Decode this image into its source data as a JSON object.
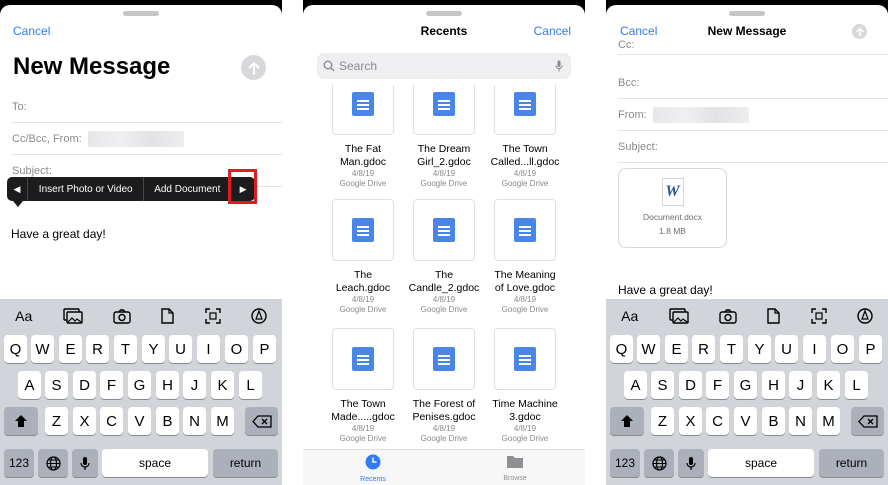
{
  "colors": {
    "accent": "#2f7cf6",
    "highlight": "#e01b24",
    "popup": "#1c1c1e",
    "keyboard": "#d1d4d9",
    "gdoc": "#4a86e8"
  },
  "panel1": {
    "cancel": "Cancel",
    "title": "New Message",
    "to_label": "To:",
    "ccbcc_label": "Cc/Bcc, From:",
    "subject_label": "Subject:",
    "popup": {
      "left_arrow": "◀",
      "item1": "Insert Photo or Video",
      "item2": "Add Document",
      "right_arrow": "▶"
    },
    "body": "Have a great day!"
  },
  "panel2": {
    "title": "Recents",
    "cancel": "Cancel",
    "search_placeholder": "Search",
    "files": [
      {
        "name1": "The Fat",
        "name2": "Man.gdoc",
        "date": "4/8/19",
        "source": "Google Drive"
      },
      {
        "name1": "The Dream",
        "name2": "Girl_2.gdoc",
        "date": "4/8/19",
        "source": "Google Drive"
      },
      {
        "name1": "The Town",
        "name2": "Called...ll.gdoc",
        "date": "4/8/19",
        "source": "Google Drive"
      },
      {
        "name1": "The",
        "name2": "Leach.gdoc",
        "date": "4/8/19",
        "source": "Google Drive"
      },
      {
        "name1": "The",
        "name2": "Candle_2.gdoc",
        "date": "4/8/19",
        "source": "Google Drive"
      },
      {
        "name1": "The Meaning",
        "name2": "of Love.gdoc",
        "date": "4/8/19",
        "source": "Google Drive"
      },
      {
        "name1": "The Town",
        "name2": "Made.....gdoc",
        "date": "4/8/19",
        "source": "Google Drive"
      },
      {
        "name1": "The Forest of",
        "name2": "Penises.gdoc",
        "date": "4/8/19",
        "source": "Google Drive"
      },
      {
        "name1": "Time Machine",
        "name2": "3.gdoc",
        "date": "4/8/19",
        "source": "Google Drive"
      }
    ],
    "tabs": {
      "recents": "Recents",
      "browse": "Browse"
    }
  },
  "panel3": {
    "cancel": "Cancel",
    "title": "New Message",
    "cc_label": "Cc:",
    "bcc_label": "Bcc:",
    "from_label": "From:",
    "subject_label": "Subject:",
    "attachment": {
      "icon_letter": "W",
      "name": "Document.docx",
      "size": "1.8 MB"
    },
    "body": "Have a great day!"
  },
  "keyboard": {
    "toolbar": [
      "Aa",
      "photo-icon",
      "camera-icon",
      "document-icon",
      "scan-icon",
      "markup-icon"
    ],
    "row1": [
      "Q",
      "W",
      "E",
      "R",
      "T",
      "Y",
      "U",
      "I",
      "O",
      "P"
    ],
    "row2": [
      "A",
      "S",
      "D",
      "F",
      "G",
      "H",
      "J",
      "K",
      "L"
    ],
    "row3": [
      "Z",
      "X",
      "C",
      "V",
      "B",
      "N",
      "M"
    ],
    "numbers": "123",
    "space": "space",
    "return": "return"
  }
}
